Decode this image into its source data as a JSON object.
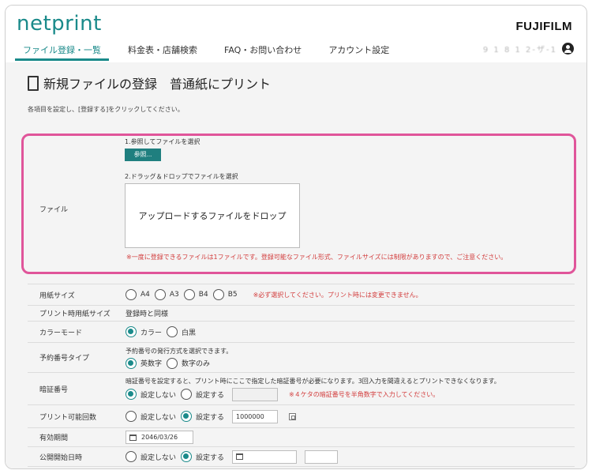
{
  "header": {
    "logo": "netprint",
    "brand": "FUJIFILM",
    "user_name": "9 1 8 1 2-ザ-1",
    "nav": [
      {
        "label": "ファイル登録・一覧",
        "active": true
      },
      {
        "label": "料金表・店舗検索",
        "active": false
      },
      {
        "label": "FAQ・お問い合わせ",
        "active": false
      },
      {
        "label": "アカウント設定",
        "active": false
      }
    ]
  },
  "page": {
    "title": "新規ファイルの登録　普通紙にプリント",
    "instruction": "各項目を設定し、[登録する]をクリックしてください。"
  },
  "file_section": {
    "label": "ファイル",
    "step1": "1.参照してファイルを選択",
    "browse_button": "参照...",
    "step2": "2.ドラッグ＆ドロップでファイルを選択",
    "drop_zone": "アップロードするファイルをドロップ",
    "note": "※一度に登録できるファイルは1ファイルです。登録可能なファイル形式、ファイルサイズには制限がありますので、ご注意ください。"
  },
  "form": {
    "paper_size": {
      "label": "用紙サイズ",
      "options": [
        "A4",
        "A3",
        "B4",
        "B5"
      ],
      "warning": "※必ず選択してください。プリント時には変更できません。"
    },
    "print_paper_size": {
      "label": "プリント時用紙サイズ",
      "value": "登録時と同様"
    },
    "color_mode": {
      "label": "カラーモード",
      "options": [
        "カラー",
        "白黒"
      ],
      "selected": "カラー"
    },
    "reservation_type": {
      "label": "予約番号タイプ",
      "hint": "予約番号の発行方式を選択できます。",
      "options": [
        "英数字",
        "数字のみ"
      ],
      "selected": "英数字"
    },
    "pin": {
      "label": "暗証番号",
      "hint": "暗証番号を設定すると、プリント時にここで指定した暗証番号が必要になります。3回入力を間違えるとプリントできなくなります。",
      "options": [
        "設定しない",
        "設定する"
      ],
      "selected": "設定しない",
      "input_value": "",
      "warning": "※４ケタの暗証番号を半角数字で入力してください。"
    },
    "print_count": {
      "label": "プリント可能回数",
      "options": [
        "設定しない",
        "設定する"
      ],
      "selected": "設定する",
      "input_value": "1000000"
    },
    "expiry": {
      "label": "有効期間",
      "value": "2046/03/26"
    },
    "publish_start": {
      "label": "公開開始日時",
      "options": [
        "設定しない",
        "設定する"
      ],
      "selected": "設定する",
      "date_value": "",
      "time_value": ""
    }
  },
  "colors": {
    "accent": "#1a8a8a",
    "highlight": "#e0559a",
    "warning": "#d23b3b",
    "background": "#f4f4f4"
  }
}
